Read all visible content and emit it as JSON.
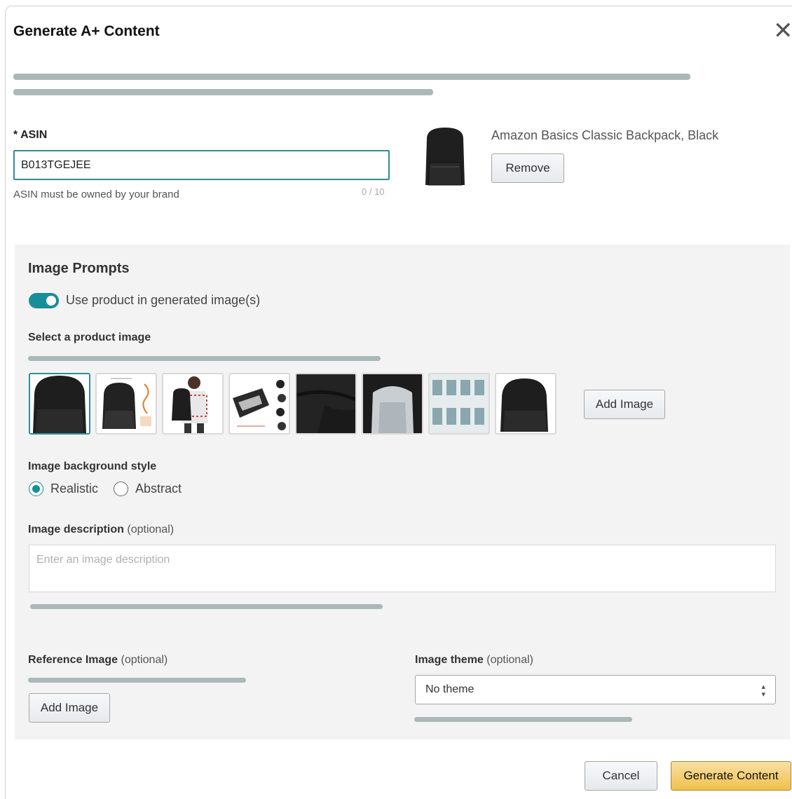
{
  "dialog": {
    "title": "Generate A+ Content",
    "close_symbol": "✕"
  },
  "asin": {
    "label": "* ASIN",
    "value": "B013TGEJEE",
    "hint": "ASIN must be owned by your brand",
    "counter": "0 / 10"
  },
  "product": {
    "name": "Amazon Basics Classic Backpack, Black",
    "remove_label": "Remove"
  },
  "image_prompts": {
    "title": "Image Prompts",
    "toggle_label": "Use product in generated image(s)",
    "toggle_on": true,
    "select_label": "Select a product image",
    "add_image_label": "Add Image",
    "thumbnails": [
      {
        "name": "backpack-front",
        "selected": true
      },
      {
        "name": "backpack-dimensions",
        "selected": false
      },
      {
        "name": "backpack-worn",
        "selected": false
      },
      {
        "name": "backpack-features",
        "selected": false
      },
      {
        "name": "backpack-closeup",
        "selected": false
      },
      {
        "name": "backpack-interior",
        "selected": false
      },
      {
        "name": "backpack-sizes",
        "selected": false
      },
      {
        "name": "backpack-angle",
        "selected": false
      }
    ]
  },
  "background_style": {
    "label": "Image background style",
    "options": [
      "Realistic",
      "Abstract"
    ],
    "selected": "Realistic"
  },
  "description": {
    "label": "Image description",
    "optional": "(optional)",
    "placeholder": "Enter an image description"
  },
  "reference_image": {
    "label": "Reference Image",
    "optional": "(optional)",
    "add_label": "Add Image"
  },
  "theme": {
    "label": "Image theme",
    "optional": "(optional)",
    "value": "No theme"
  },
  "footer": {
    "cancel_label": "Cancel",
    "generate_label": "Generate Content"
  },
  "colors": {
    "accent": "#178e98",
    "primary_button": "#f0c14b",
    "panel": "#f3f3f3"
  }
}
